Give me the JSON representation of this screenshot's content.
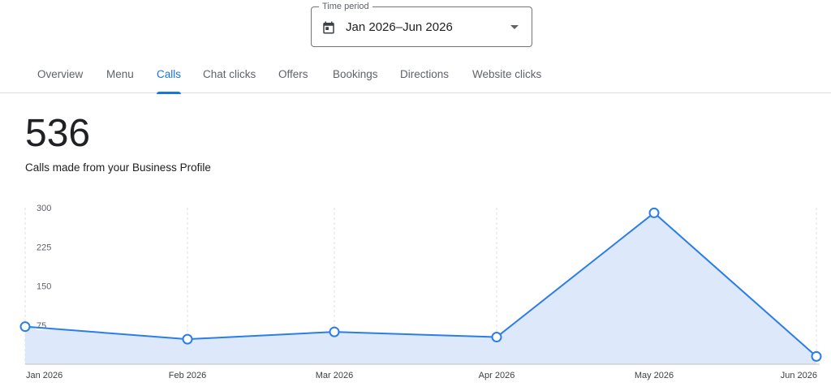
{
  "time_period": {
    "label": "Time period",
    "value": "Jan 2026–Jun 2026",
    "icon": "calendar-icon",
    "dropdown_icon": "arrow-drop-down-icon"
  },
  "tabs": [
    {
      "label": "Overview",
      "active": false
    },
    {
      "label": "Menu",
      "active": false
    },
    {
      "label": "Calls",
      "active": true
    },
    {
      "label": "Chat clicks",
      "active": false
    },
    {
      "label": "Offers",
      "active": false
    },
    {
      "label": "Bookings",
      "active": false
    },
    {
      "label": "Directions",
      "active": false
    },
    {
      "label": "Website clicks",
      "active": false
    }
  ],
  "metric": {
    "value": "536",
    "caption": "Calls made from your Business Profile"
  },
  "colors": {
    "accent": "#1a73e8",
    "line": "#2b7de9",
    "area_fill": "#dde9fa",
    "text_secondary": "#5f6368",
    "grid": "#dadce0"
  },
  "chart_data": {
    "type": "area",
    "categories": [
      "Jan 2026",
      "Feb 2026",
      "Mar 2026",
      "Apr 2026",
      "May 2026",
      "Jun 2026"
    ],
    "series": [
      {
        "values": [
          72,
          48,
          62,
          52,
          290,
          15
        ]
      }
    ],
    "y_ticks": [
      "300",
      "225",
      "150",
      "75"
    ],
    "ylim": [
      0,
      300
    ],
    "grid": "vertical dashed",
    "legend": "none"
  }
}
